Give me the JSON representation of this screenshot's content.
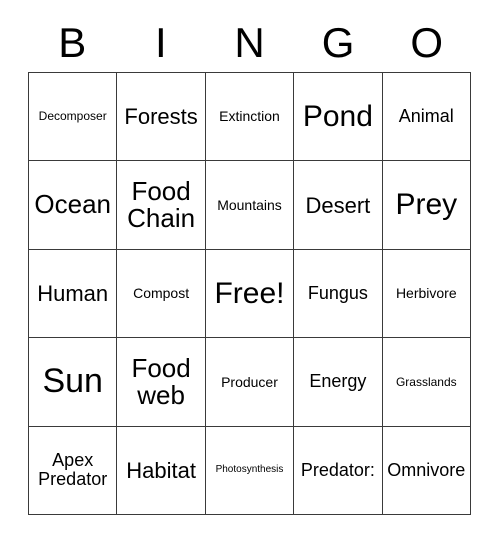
{
  "card": {
    "header_letters": [
      "B",
      "I",
      "N",
      "G",
      "O"
    ],
    "free_space_index": 12,
    "colors": {
      "background": "#ffffff",
      "text": "#000000",
      "grid_line": "#3a3a3a"
    },
    "cells": [
      {
        "label": "Decomposer",
        "size": "sm"
      },
      {
        "label": "Forests",
        "size": "xl"
      },
      {
        "label": "Extinction",
        "size": "md"
      },
      {
        "label": "Pond",
        "size": "3xl"
      },
      {
        "label": "Animal",
        "size": "lg"
      },
      {
        "label": "Ocean",
        "size": "2xl"
      },
      {
        "label": "Food\nChain",
        "size": "2xl"
      },
      {
        "label": "Mountains",
        "size": "md"
      },
      {
        "label": "Desert",
        "size": "xl"
      },
      {
        "label": "Prey",
        "size": "3xl"
      },
      {
        "label": "Human",
        "size": "xl"
      },
      {
        "label": "Compost",
        "size": "md"
      },
      {
        "label": "Free!",
        "size": "3xl"
      },
      {
        "label": "Fungus",
        "size": "lg"
      },
      {
        "label": "Herbivore",
        "size": "md"
      },
      {
        "label": "Sun",
        "size": "4xl"
      },
      {
        "label": "Food\nweb",
        "size": "2xl"
      },
      {
        "label": "Producer",
        "size": "md"
      },
      {
        "label": "Energy",
        "size": "lg"
      },
      {
        "label": "Grasslands",
        "size": "sm"
      },
      {
        "label": "Apex\nPredator",
        "size": "lg"
      },
      {
        "label": "Habitat",
        "size": "xl"
      },
      {
        "label": "Photosynthesis",
        "size": "xs"
      },
      {
        "label": "Predator:",
        "size": "lg"
      },
      {
        "label": "Omnivore",
        "size": "lg"
      }
    ]
  }
}
